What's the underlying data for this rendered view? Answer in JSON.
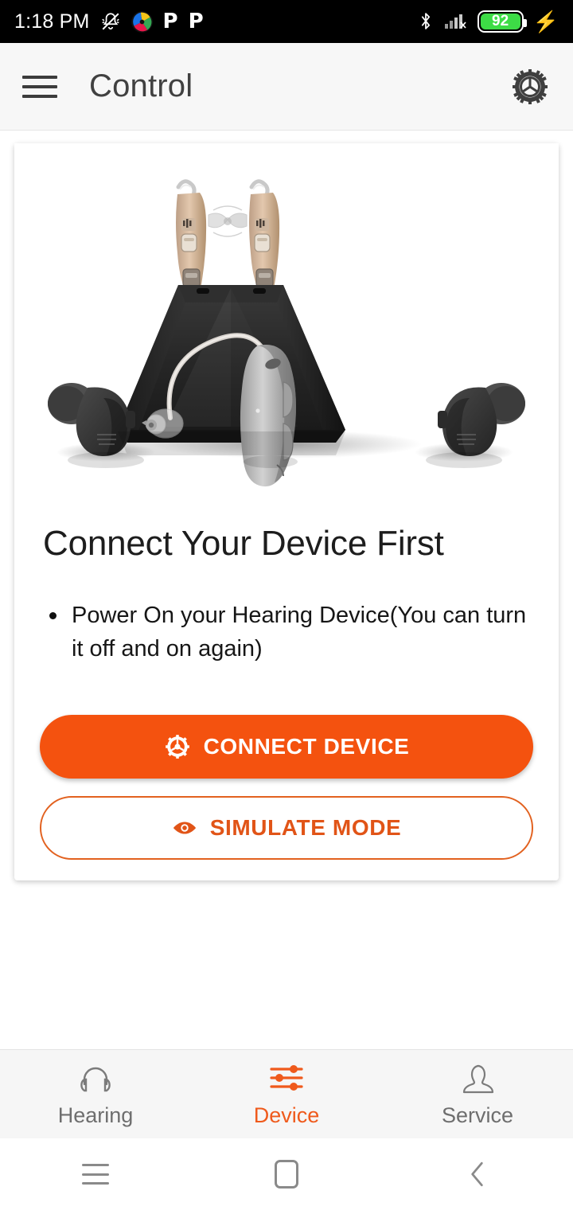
{
  "statusbar": {
    "time": "1:18 PM",
    "icons": [
      {
        "name": "notifications-silenced-icon",
        "glyph": "bell-slash"
      },
      {
        "name": "app-logo-icon",
        "glyph": "color-pinwheel"
      },
      {
        "name": "app-p-icon-1",
        "glyph": "P"
      },
      {
        "name": "app-p-icon-2",
        "glyph": "P"
      }
    ],
    "p_label": "P",
    "bluetooth_name": "bluetooth-icon",
    "signal_name": "signal-no-sim-icon",
    "battery_level": "92",
    "battery_color": "#3ddc46",
    "charging_glyph": "⚡"
  },
  "appbar": {
    "menu_label": "menu-icon",
    "title": "Control",
    "settings_label": "settings-gear-icon"
  },
  "card": {
    "hero_alt": "hearing-aids-and-charger-photo",
    "title": "Connect Your Device First",
    "bullets": [
      "Power On your Hearing Device(You can turn it off and on again)"
    ],
    "primary_button": {
      "label": "CONNECT DEVICE",
      "icon": "gear-icon",
      "bg": "#f4520f",
      "text_color": "#ffffff"
    },
    "secondary_button": {
      "label": "SIMULATE MODE",
      "icon": "eye-icon",
      "border_color": "#e2611f",
      "text_color": "#e15417"
    }
  },
  "bottomnav": {
    "active_color": "#ef5a1c",
    "inactive_color": "#6e6e6e",
    "items": [
      {
        "label": "Hearing",
        "icon": "headphones-icon",
        "active": false
      },
      {
        "label": "Device",
        "icon": "sliders-icon",
        "active": true
      },
      {
        "label": "Service",
        "icon": "person-icon",
        "active": false
      }
    ]
  },
  "systembar": {
    "recents": "recents-icon",
    "home": "home-icon",
    "back": "back-icon",
    "back_glyph": "‹"
  }
}
